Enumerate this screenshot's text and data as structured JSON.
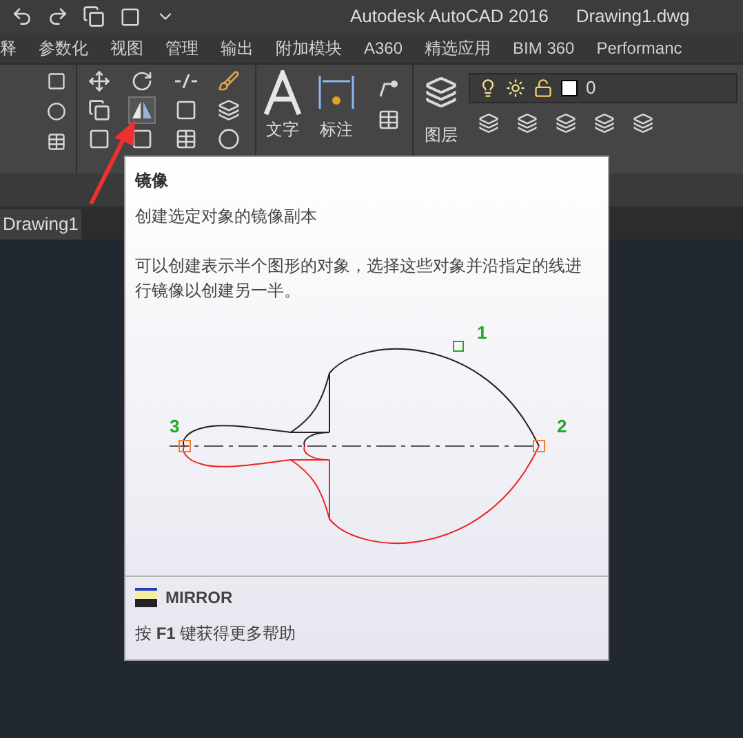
{
  "title_bar": {
    "title": "Autodesk AutoCAD 2016",
    "file": "Drawing1.dwg"
  },
  "ribbon_tabs": [
    "释",
    "参数化",
    "视图",
    "管理",
    "输出",
    "附加模块",
    "A360",
    "精选应用",
    "BIM 360",
    "Performanc"
  ],
  "ribbon": {
    "text_label": "文字",
    "dimension_label": "标注",
    "layer_label": "图层",
    "current_layer": "0"
  },
  "file_tabs": [
    {
      "label": "Drawing1"
    }
  ],
  "tooltip": {
    "title": "镜像",
    "summary": "创建选定对象的镜像副本",
    "description": "可以创建表示半个图形的对象，选择这些对象并沿指定的线进行镜像以创建另一半。",
    "points": [
      "1",
      "2",
      "3"
    ],
    "command": "MIRROR",
    "help": "按 **F1** 键获得更多帮助"
  }
}
